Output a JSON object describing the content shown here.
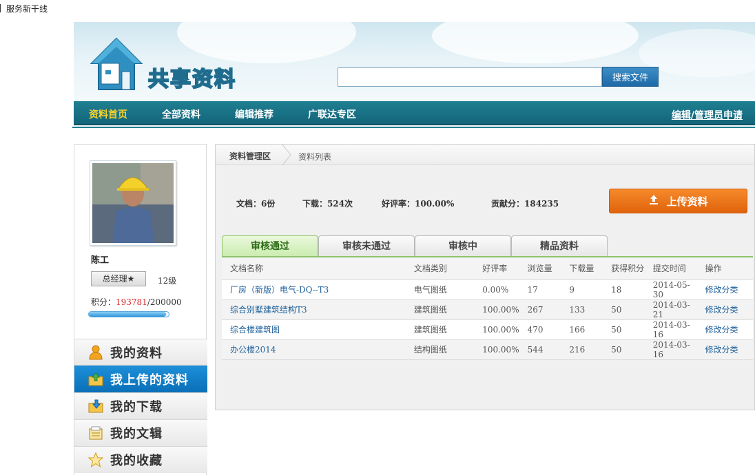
{
  "topbar": {
    "label": "服务新干线"
  },
  "header": {
    "logo_text": "共享资料",
    "search": {
      "placeholder": "",
      "button": "搜索文件"
    }
  },
  "nav": {
    "items": [
      "资料首页",
      "全部资料",
      "编辑推荐",
      "广联达专区"
    ],
    "active_index": 0,
    "apply": "编辑/管理员申请"
  },
  "profile": {
    "name": "陈工",
    "title": "总经理★",
    "level": "12级",
    "points_label": "积分：",
    "points_current": "193781",
    "points_total": "/200000",
    "progress": 0.969
  },
  "sidebar_menu": [
    {
      "label": "我的资料",
      "icon": "person-icon"
    },
    {
      "label": "我上传的资料",
      "icon": "upload-folder-icon",
      "active": true
    },
    {
      "label": "我的下载",
      "icon": "download-folder-icon"
    },
    {
      "label": "我的文辑",
      "icon": "album-icon"
    },
    {
      "label": "我的收藏",
      "icon": "star-icon"
    }
  ],
  "breadcrumb": {
    "section": "资料管理区",
    "page": "资料列表"
  },
  "stats": {
    "docs_label": "文档：",
    "docs_value": "6份",
    "downloads_label": "下载：",
    "downloads_value": "524次",
    "rating_label": "好评率：",
    "rating_value": "100.00%",
    "contrib_label": "贡献分：",
    "contrib_value": "184235"
  },
  "upload_button": "上传资料",
  "tabs": [
    "审核通过",
    "审核未通过",
    "审核中",
    "精品资料"
  ],
  "table": {
    "headers": [
      "文档名称",
      "文档类别",
      "好评率",
      "浏览量",
      "下载量",
      "获得积分",
      "提交时间",
      "操作"
    ],
    "rows": [
      [
        "厂房（新版）电气-DQ--T3",
        "电气图纸",
        "0.00%",
        "17",
        "9",
        "18",
        "2014-05-30",
        "修改分类"
      ],
      [
        "综合别墅建筑结构T3",
        "建筑图纸",
        "100.00%",
        "267",
        "133",
        "50",
        "2014-03-21",
        "修改分类"
      ],
      [
        "综合楼建筑图",
        "建筑图纸",
        "100.00%",
        "470",
        "166",
        "50",
        "2014-03-16",
        "修改分类"
      ],
      [
        "办公楼2014",
        "结构图纸",
        "100.00%",
        "544",
        "216",
        "50",
        "2014-03-16",
        "修改分类"
      ]
    ]
  },
  "colors": {
    "nav_bg": "#1a7286",
    "nav_active": "#f7d22b",
    "menu_active": "#1283cc",
    "upload": "#ef7a1c",
    "tab_active": "#c9ecae"
  }
}
